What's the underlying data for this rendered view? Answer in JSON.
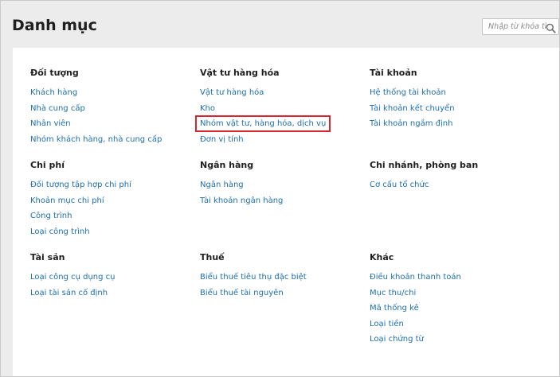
{
  "page": {
    "title": "Danh mục"
  },
  "search": {
    "placeholder": "Nhập từ khóa tìm"
  },
  "groups": [
    {
      "title": "Đối tượng",
      "links": [
        "Khách hàng",
        "Nhà cung cấp",
        "Nhân viên",
        "Nhóm khách hàng, nhà cung cấp"
      ]
    },
    {
      "title": "Vật tư hàng hóa",
      "links": [
        "Vật tư hàng hóa",
        "Kho",
        "Nhóm vật tư, hàng hóa, dịch vụ",
        "Đơn vị tính"
      ]
    },
    {
      "title": "Tài khoản",
      "links": [
        "Hệ thống tài khoản",
        "Tài khoản kết chuyển",
        "Tài khoản ngầm định"
      ]
    },
    {
      "title": "Chi phí",
      "links": [
        "Đối tượng tập hợp chi phí",
        "Khoản mục chi phí",
        "Công trình",
        "Loại công trình"
      ]
    },
    {
      "title": "Ngân hàng",
      "links": [
        "Ngân hàng",
        "Tài khoản ngân hàng"
      ]
    },
    {
      "title": "Chi nhánh, phòng ban",
      "links": [
        "Cơ cấu tổ chức"
      ]
    },
    {
      "title": "Tài sản",
      "links": [
        "Loại công cụ dụng cụ",
        "Loại tài sản cố định"
      ]
    },
    {
      "title": "Thuế",
      "links": [
        "Biểu thuế tiêu thụ đặc biệt",
        "Biểu thuế tài nguyên"
      ]
    },
    {
      "title": "Khác",
      "links": [
        "Điều khoản thanh toán",
        "Mục thu/chi",
        "Mã thống kê",
        "Loại tiền",
        "Loại chứng từ"
      ]
    }
  ],
  "highlight": {
    "color": "#d9262c"
  },
  "colors": {
    "link": "#1e6fae",
    "heading": "#1f1f1f",
    "background": "#ececec",
    "panel": "#ffffff"
  }
}
